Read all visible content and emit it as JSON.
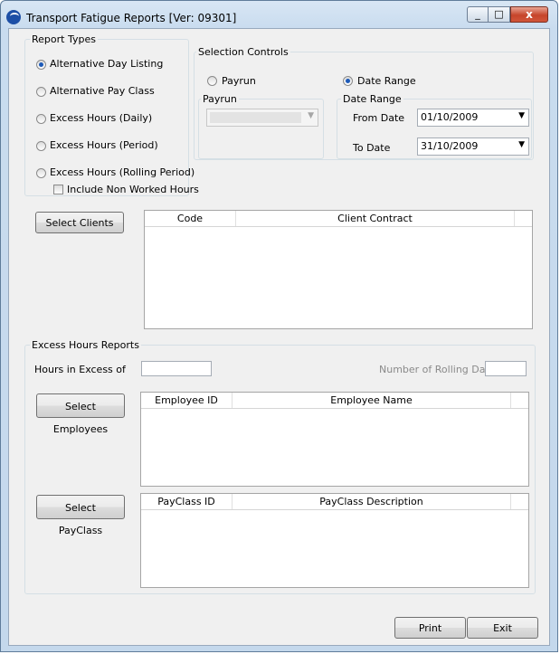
{
  "window": {
    "title": "Transport Fatigue Reports [Ver: 09301]",
    "close_glyph": "x",
    "minimize_glyph": "_",
    "maximize_glyph": "□"
  },
  "report_types": {
    "legend": "Report Types",
    "options": [
      {
        "label": "Alternative Day Listing",
        "selected": true
      },
      {
        "label": "Alternative Pay Class",
        "selected": false
      },
      {
        "label": "Excess Hours (Daily)",
        "selected": false
      },
      {
        "label": "Excess Hours (Period)",
        "selected": false
      },
      {
        "label": "Excess Hours (Rolling Period)",
        "selected": false
      }
    ],
    "include_non_worked": {
      "label": "Include Non Worked Hours",
      "checked": false
    }
  },
  "selection_controls": {
    "legend": "Selection Controls",
    "payrun_radio": "Payrun",
    "date_range_radio": "Date Range",
    "payrun_group": "Payrun",
    "date_range_group": "Date Range",
    "from_date_label": "From Date",
    "from_date": "01/10/2009",
    "to_date_label": "To Date",
    "to_date": "31/10/2009",
    "selected": "Date Range"
  },
  "clients": {
    "button": "Select Clients",
    "columns": [
      "Code",
      "Client Contract"
    ]
  },
  "excess_hours": {
    "legend": "Excess Hours Reports",
    "hours_label": "Hours in Excess of",
    "hours_value": "",
    "rolling_label": "Number of Rolling Days",
    "rolling_value": "",
    "employees_button": "Select Employees",
    "employee_columns": [
      "Employee ID",
      "Employee Name"
    ],
    "payclass_button": "Select PayClass",
    "payclass_columns": [
      "PayClass ID",
      "PayClass Description"
    ]
  },
  "footer": {
    "print": "Print",
    "exit": "Exit"
  },
  "colors": {
    "accent": "#1d5ab8",
    "close": "#c6452b",
    "frame": "#c4d8ec",
    "dialog": "#f0f0f0"
  }
}
